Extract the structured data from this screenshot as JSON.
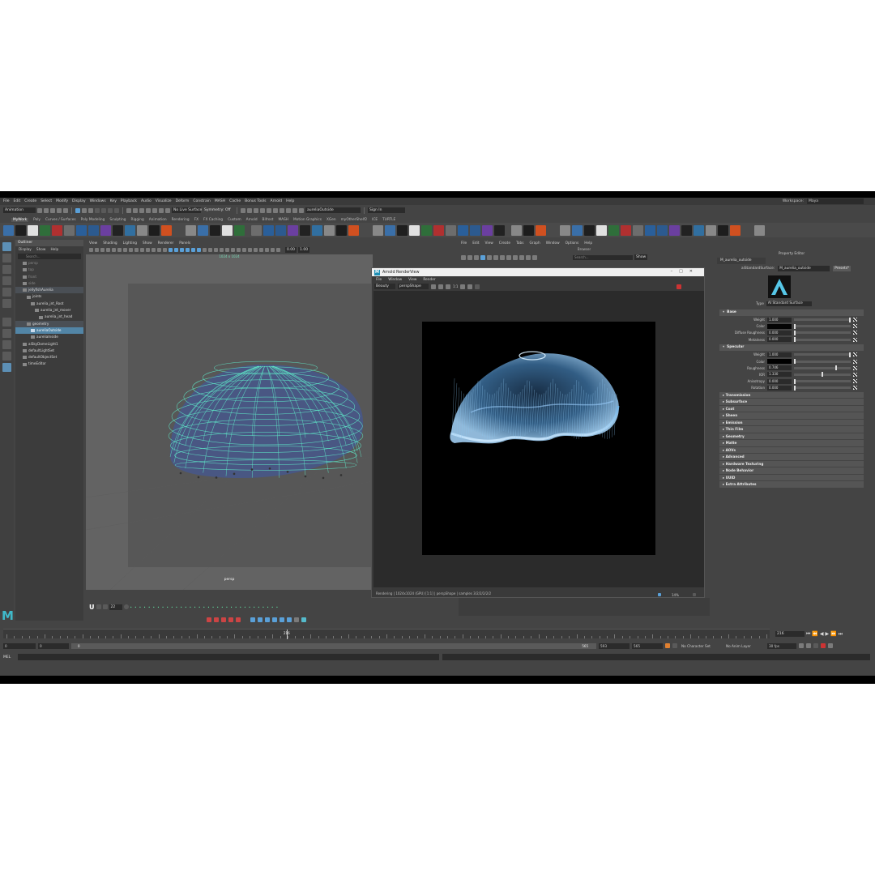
{
  "menubar": [
    "File",
    "Edit",
    "Create",
    "Select",
    "Modify",
    "Display",
    "Windows",
    "Key",
    "Playback",
    "Audio",
    "Visualize",
    "Deform",
    "Constrain",
    "MASH",
    "Cache",
    "Bonus Tools",
    "Arnold",
    "Help"
  ],
  "workspace": {
    "label": "Workspace:",
    "value": "Maya"
  },
  "statusline": {
    "mode": "Animation",
    "live_surface": "No Live Surface",
    "symmetry": "Symmetry: Off",
    "object_field": "aureliaOutside",
    "sign_in": "Sign In"
  },
  "shelf_tabs": [
    "MyWork",
    "Poly",
    "Curves / Surfaces",
    "Poly Modeling",
    "Sculpting",
    "Rigging",
    "Animation",
    "Rendering",
    "FX",
    "FX Caching",
    "Custom",
    "Arnold",
    "Bifrost",
    "MASH",
    "Motion Graphics",
    "XGen",
    "myOtherShelf2",
    "ICE",
    "TURTLE"
  ],
  "outliner": {
    "title": "Outliner",
    "menu": [
      "Display",
      "Show",
      "Help"
    ],
    "search_placeholder": "Search...",
    "items": [
      {
        "label": "persp",
        "indent": 1,
        "dim": true
      },
      {
        "label": "top",
        "indent": 1,
        "dim": true
      },
      {
        "label": "front",
        "indent": 1,
        "dim": true
      },
      {
        "label": "side",
        "indent": 1,
        "dim": true
      },
      {
        "label": "jellyfishAurelia",
        "indent": 1,
        "dim": false,
        "selected": false,
        "hl": true
      },
      {
        "label": "joints",
        "indent": 2,
        "dim": false
      },
      {
        "label": "aurelia_jnt_Root",
        "indent": 3,
        "dim": false
      },
      {
        "label": "aurelia_jnt_mover",
        "indent": 4,
        "dim": false
      },
      {
        "label": "aurelia_jnt_head",
        "indent": 5,
        "dim": false
      },
      {
        "label": "geometry",
        "indent": 2,
        "dim": false,
        "hl": true
      },
      {
        "label": "aureliaOutside",
        "indent": 3,
        "dim": false,
        "selected": true
      },
      {
        "label": "aureliaInside",
        "indent": 3,
        "dim": false
      },
      {
        "label": "aiSkyDomeLight1",
        "indent": 1,
        "dim": false
      },
      {
        "label": "defaultLightSet",
        "indent": 1,
        "dim": false
      },
      {
        "label": "defaultObjectSet",
        "indent": 1,
        "dim": false
      },
      {
        "label": "timeEditor",
        "indent": 1,
        "dim": false
      }
    ]
  },
  "viewport": {
    "menu": [
      "View",
      "Shading",
      "Lighting",
      "Show",
      "Renderer",
      "Panels"
    ],
    "resolution": "1024 x 1024",
    "camera": "persp",
    "field_a": "0.00",
    "field_b": "1.00"
  },
  "renderview": {
    "title": "Arnold RenderView",
    "menu": [
      "File",
      "Window",
      "View",
      "Render"
    ],
    "aov": "Beauty",
    "camera": "perspShape",
    "zoom": "1:1",
    "status": "Rendering | 1024x1024 (GPU) [1:1] | perspShape | samples 3/2/2/2/2/2"
  },
  "node_editor": {
    "menu": [
      "File",
      "Edit",
      "View",
      "Create",
      "Tabs",
      "Graph",
      "Window",
      "Options",
      "Help"
    ],
    "title": "Browser",
    "search_placeholder": "Search...",
    "show_label": "Show",
    "zoom": "14%"
  },
  "property_editor": {
    "header": "Property Editor",
    "tab": "M_aurelia_outside",
    "node_type": "aiStandardSurface:",
    "node_name": "M_aurelia_outside",
    "presets": "Presets*",
    "type_label": "Type",
    "type_value": "AI Standard Surface",
    "sections": {
      "base": {
        "title": "Base",
        "attrs": [
          {
            "label": "Weight",
            "value": "1.000",
            "kind": "slider",
            "pos": 1.0
          },
          {
            "label": "Color",
            "value": "",
            "kind": "color",
            "color": "#050505"
          },
          {
            "label": "Diffuse Roughness",
            "value": "0.000",
            "kind": "slider",
            "pos": 0.0
          },
          {
            "label": "Metalness",
            "value": "0.000",
            "kind": "slider",
            "pos": 0.0
          }
        ]
      },
      "specular": {
        "title": "Specular",
        "attrs": [
          {
            "label": "Weight",
            "value": "1.000",
            "kind": "slider",
            "pos": 1.0
          },
          {
            "label": "Color",
            "value": "",
            "kind": "color",
            "color": "#000000"
          },
          {
            "label": "Roughness",
            "value": "0.746",
            "kind": "slider",
            "pos": 0.75
          },
          {
            "label": "IOR",
            "value": "1.330",
            "kind": "slider",
            "pos": 0.5
          },
          {
            "label": "Anisotropy",
            "value": "0.000",
            "kind": "slider",
            "pos": 0.0
          },
          {
            "label": "Rotation",
            "value": "0.000",
            "kind": "slider",
            "pos": 0.0
          }
        ]
      }
    },
    "collapsed": [
      "Transmission",
      "Subsurface",
      "Coat",
      "Sheen",
      "Emission",
      "Thin Film",
      "Geometry",
      "Matte",
      "AOVs",
      "Advanced",
      "Hardware Texturing",
      "Node Behavior",
      "UUID",
      "Extra Attributes"
    ]
  },
  "timeline": {
    "current_frame": "216",
    "field_current": "216",
    "range_start": "0",
    "anim_start": "0",
    "range_bar_start": "0",
    "range_bar_end": "565",
    "range_end": "593",
    "anim_end": "565",
    "character_set": "No Character Set",
    "anim_layer": "No Anim Layer",
    "fps": "30 fps",
    "playhead_fraction": 0.37
  },
  "cmdline": {
    "label": "MEL"
  },
  "colors": {
    "accent_blue": "#5285a6",
    "wireframe": "#5fe8c8",
    "maya_logo": "#3fb9c9"
  }
}
